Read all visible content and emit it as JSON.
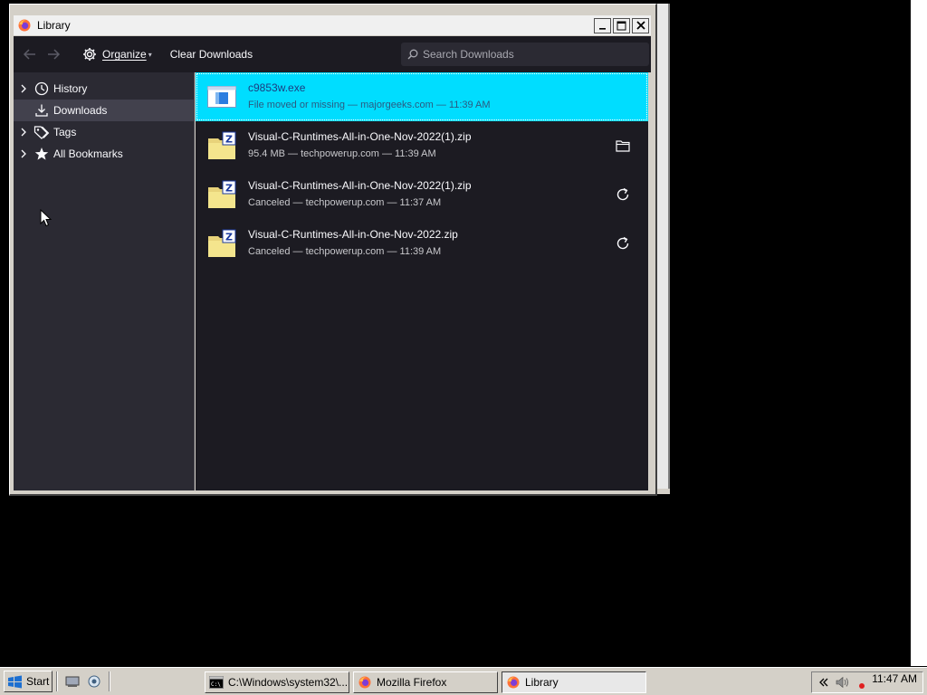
{
  "window": {
    "title": "Library",
    "controls": [
      "minimize",
      "maximize",
      "close"
    ]
  },
  "toolbar": {
    "back_icon": "arrow-left-icon",
    "forward_icon": "arrow-right-icon",
    "organize_label": "Organize",
    "clear_label": "Clear Downloads",
    "search_placeholder": "Search Downloads"
  },
  "sidebar": {
    "items": [
      {
        "label": "History",
        "icon": "clock-icon",
        "expandable": true,
        "selected": false
      },
      {
        "label": "Downloads",
        "icon": "download-icon",
        "expandable": false,
        "selected": true
      },
      {
        "label": "Tags",
        "icon": "tag-icon",
        "expandable": true,
        "selected": false
      },
      {
        "label": "All Bookmarks",
        "icon": "star-icon",
        "expandable": true,
        "selected": false
      }
    ]
  },
  "downloads": [
    {
      "name": "c9853w.exe",
      "status": "File moved or missing — majorgeeks.com — 11:39 AM",
      "file_icon": "exe-icon",
      "action": "",
      "selected": true
    },
    {
      "name": "Visual-C-Runtimes-All-in-One-Nov-2022(1).zip",
      "status": "95.4 MB — techpowerup.com — 11:39 AM",
      "file_icon": "zip-icon",
      "action": "folder-icon",
      "selected": false
    },
    {
      "name": "Visual-C-Runtimes-All-in-One-Nov-2022(1).zip",
      "status": "Canceled — techpowerup.com — 11:37 AM",
      "file_icon": "zip-icon",
      "action": "retry-icon",
      "selected": false
    },
    {
      "name": "Visual-C-Runtimes-All-in-One-Nov-2022.zip",
      "status": "Canceled — techpowerup.com — 11:39 AM",
      "file_icon": "zip-icon",
      "action": "retry-icon",
      "selected": false
    }
  ],
  "taskbar": {
    "start_label": "Start",
    "tasks": [
      {
        "label": "C:\\Windows\\system32\\...",
        "icon": "cmd-icon",
        "active": false
      },
      {
        "label": "Mozilla Firefox",
        "icon": "firefox-icon",
        "active": false
      },
      {
        "label": "Library",
        "icon": "firefox-icon",
        "active": true
      }
    ],
    "clock": "11:47 AM"
  },
  "colors": {
    "accent": "#00ddff",
    "toolbar_bg": "#1c1b22",
    "sidebar_bg": "#2b2a33"
  }
}
